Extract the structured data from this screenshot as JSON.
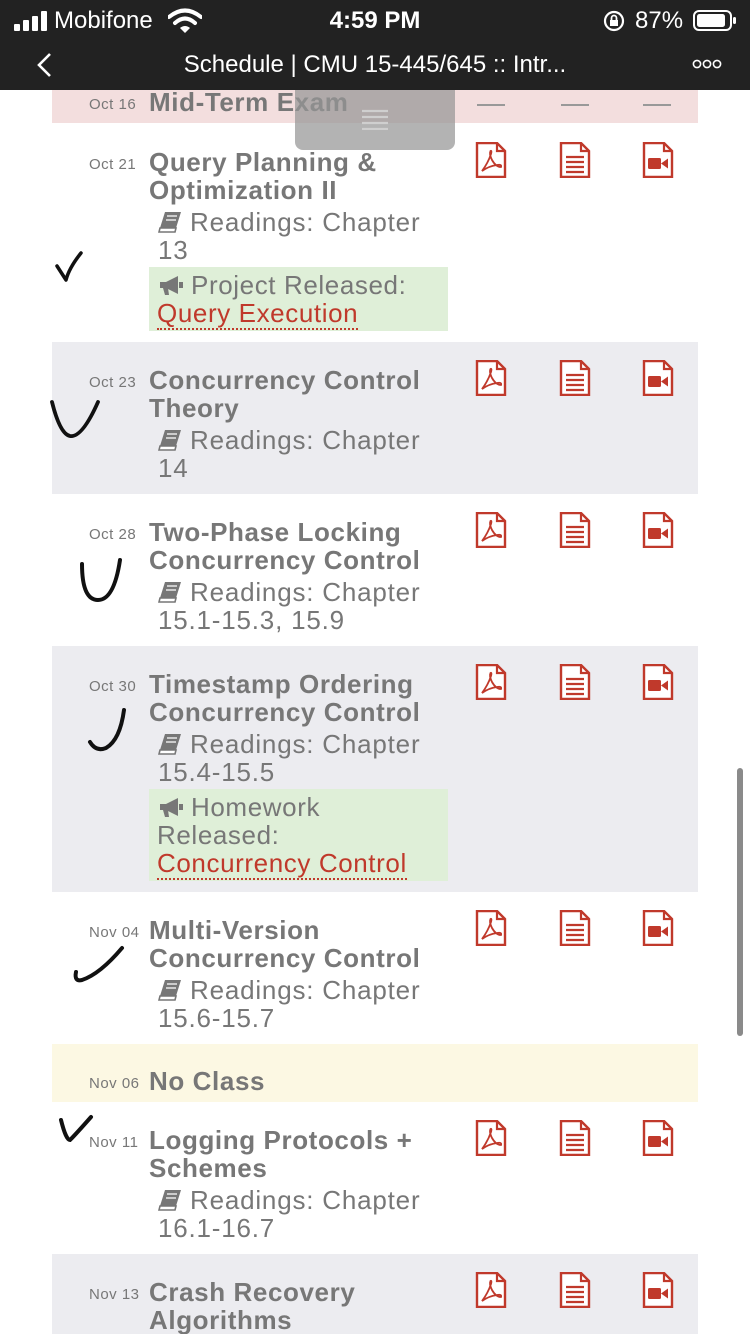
{
  "status_bar": {
    "carrier": "Mobifone",
    "time": "4:59 PM",
    "battery": "87%"
  },
  "nav": {
    "title": "Schedule | CMU 15-445/645 :: Intr..."
  },
  "rows": [
    {
      "date": "Oct 16",
      "title": "Mid-Term Exam"
    },
    {
      "date": "Oct 21",
      "title": "Query Planning & Optimization II",
      "readings": "Readings: Chapter 13",
      "announcement": {
        "text": "Project Released:",
        "link": "Query Execution"
      }
    },
    {
      "date": "Oct 23",
      "title": "Concurrency Control Theory",
      "readings": "Readings: Chapter 14"
    },
    {
      "date": "Oct 28",
      "title": "Two-Phase Locking Concurrency Control",
      "readings": "Readings: Chapter 15.1-15.3, 15.9"
    },
    {
      "date": "Oct 30",
      "title": "Timestamp Ordering Concurrency Control",
      "readings": "Readings: Chapter 15.4-15.5",
      "announcement": {
        "text": "Homework Released:",
        "link": "Concurrency Control"
      }
    },
    {
      "date": "Nov 04",
      "title": "Multi-Version Concurrency Control",
      "readings": "Readings: Chapter 15.6-15.7"
    },
    {
      "date": "Nov 06",
      "title": "No Class"
    },
    {
      "date": "Nov 11",
      "title": "Logging Protocols + Schemes",
      "readings": "Readings: Chapter 16.1-16.7"
    },
    {
      "date": "Nov 13",
      "title": "Crash Recovery Algorithms"
    }
  ],
  "icons": {
    "slides": "pdf-icon",
    "notes": "notes-icon",
    "video": "video-icon",
    "readings": "book-icon",
    "announcement": "megaphone-icon"
  },
  "colors": {
    "accent": "#c0392b",
    "exam_row": "#f3dede",
    "alt_row": "#ececf0",
    "no_class_row": "#fcf8e3",
    "announcement_bg": "#dfefd8"
  }
}
